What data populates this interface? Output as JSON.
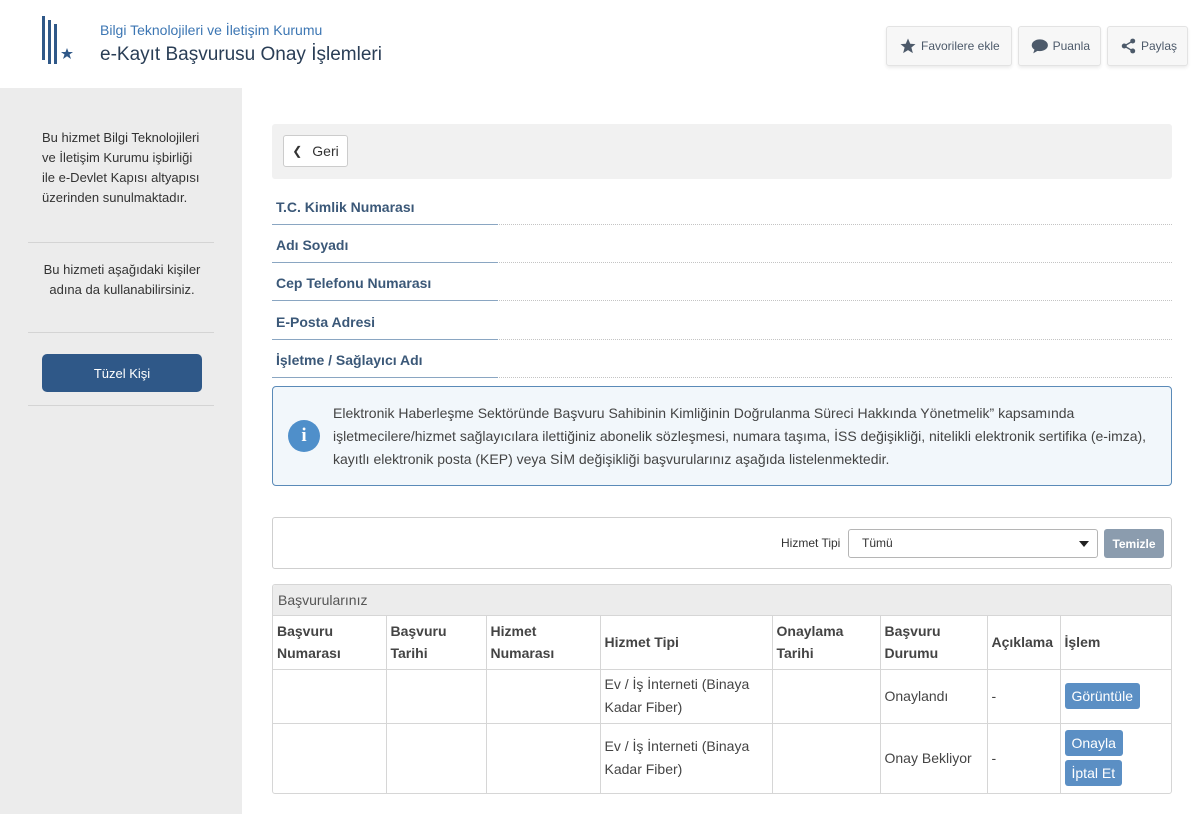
{
  "header": {
    "org_name": "Bilgi Teknolojileri ve İletişim Kurumu",
    "page_title": "e-Kayıt Başvurusu Onay İşlemleri",
    "buttons": {
      "favorite": "Favorilere ekle",
      "rate": "Puanla",
      "share": "Paylaş"
    }
  },
  "sidebar": {
    "info": "Bu hizmet Bilgi Teknolojileri ve İletişim Kurumu işbirliği ile e-Devlet Kapısı altyapısı üzerinden sunulmaktadır.",
    "note": "Bu hizmeti aşağıdaki kişiler adına da kullanabilirsiniz.",
    "tuzel_button": "Tüzel Kişi"
  },
  "main": {
    "back_label": "Geri",
    "fields": [
      {
        "label": "T.C. Kimlik Numarası"
      },
      {
        "label": "Adı Soyadı"
      },
      {
        "label": "Cep Telefonu Numarası"
      },
      {
        "label": "E-Posta Adresi"
      },
      {
        "label": "İşletme / Sağlayıcı Adı"
      }
    ],
    "info_text": "Elektronik Haberleşme Sektöründe Başvuru Sahibinin Kimliğinin Doğrulanma Süreci Hakkında Yönetmelik” kapsamında işletmecilere/hizmet sağlayıcılara ilettiğiniz abonelik sözleşmesi, numara taşıma, İSS değişikliği, nitelikli elektronik sertifika (e-imza), kayıtlı elektronik posta (KEP) veya SİM değişikliği başvurularınız aşağıda listelenmektedir.",
    "filter": {
      "label": "Hizmet Tipi",
      "selected": "Tümü",
      "clear": "Temizle"
    },
    "table": {
      "title": "Başvurularınız",
      "columns": [
        "Başvuru Numarası",
        "Başvuru Tarihi",
        "Hizmet Numarası",
        "Hizmet Tipi",
        "Onaylama Tarihi",
        "Başvuru Durumu",
        "Açıklama",
        "İşlem"
      ],
      "rows": [
        {
          "no": "",
          "date": "",
          "service_no": "",
          "type": "Ev / İş İnterneti (Binaya Kadar Fiber)",
          "approval_date": "",
          "status": "Onaylandı",
          "note": "-",
          "actions": [
            "Görüntüle"
          ]
        },
        {
          "no": "",
          "date": "",
          "service_no": "",
          "type": "Ev / İş İnterneti (Binaya Kadar Fiber)",
          "approval_date": "",
          "status": "Onay Bekliyor",
          "note": "-",
          "actions": [
            "Onayla",
            "İptal Et"
          ]
        }
      ]
    }
  },
  "colors": {
    "brand_dark": "#2f5888",
    "brand_blue": "#3c76b3",
    "action_button": "#5b8fc4"
  }
}
